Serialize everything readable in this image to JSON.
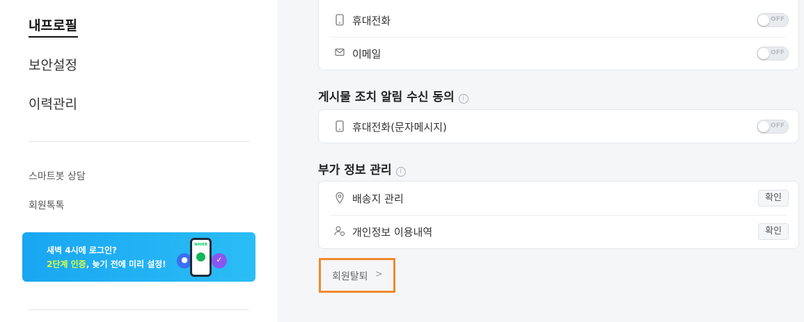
{
  "sidebar": {
    "nav": [
      {
        "label": "내프로필"
      },
      {
        "label": "보안설정"
      },
      {
        "label": "이력관리"
      }
    ],
    "sub": [
      {
        "label": "스마트봇 상담"
      },
      {
        "label": "회원톡톡"
      }
    ],
    "banner": {
      "line1": "새벽 4시에 로그인?",
      "line2_highlight": "2단계 인증",
      "line2_rest": ", 늦기 전에 미리 설정!",
      "phone_brand": "NAVER"
    }
  },
  "notifications": {
    "rows": [
      {
        "label": "휴대전화",
        "toggle": "OFF"
      },
      {
        "label": "이메일",
        "toggle": "OFF"
      }
    ]
  },
  "post_action": {
    "title": "게시물 조치 알림 수신 동의",
    "info": "i",
    "rows": [
      {
        "label": "휴대전화(문자메시지)",
        "toggle": "OFF"
      }
    ]
  },
  "extra_info": {
    "title": "부가 정보 관리",
    "info": "i",
    "rows": [
      {
        "label": "배송지 관리",
        "button": "확인"
      },
      {
        "label": "개인정보 이용내역",
        "button": "확인"
      }
    ]
  },
  "withdraw": {
    "label": "회원탈퇴",
    "chevron": ">"
  },
  "colors": {
    "accent_highlight": "#f0892e",
    "banner_blue": "#19a6f2",
    "banner_highlight": "#d8ff3b"
  }
}
